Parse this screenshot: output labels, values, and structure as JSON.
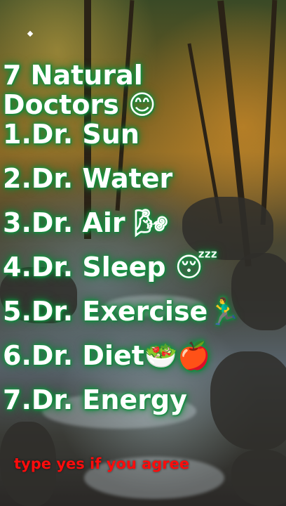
{
  "overlay": {
    "title_line1": "7 Natural",
    "title_line2": "Doctors 😊",
    "items": [
      "1.Dr. Sun",
      "2.Dr. Water",
      "3.Dr. Air 🌬",
      "4.Dr. Sleep 😴",
      "5.Dr. Exercise🏃‍♂️",
      "6.Dr. Diet🥗🍎",
      "7.Dr. Energy"
    ],
    "call_to_action": "type yes if you agree"
  },
  "colors": {
    "text": "#ffffff",
    "glow": "#1aa84a",
    "call_to_action": "#ff0c0c"
  }
}
